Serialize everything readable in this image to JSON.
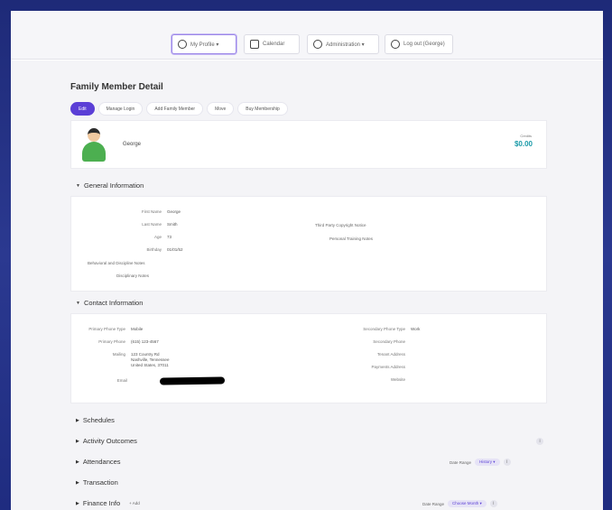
{
  "topbar": {
    "buttons": [
      {
        "label": "My Profile ▾",
        "icon": "user-circle-icon"
      },
      {
        "label": "Calendar",
        "icon": "calendar-icon"
      },
      {
        "label": "Administration ▾",
        "icon": "gear-icon"
      },
      {
        "label": "Log out (George)",
        "icon": "logout-icon"
      }
    ]
  },
  "page": {
    "title": "Family Member Detail",
    "tabs": [
      "Edit",
      "Manage Login",
      "Add Family Member",
      "Move",
      "Buy Membership"
    ]
  },
  "profile": {
    "name": "George",
    "stat_label": "Credits",
    "stat_value": "$0.00"
  },
  "general": {
    "header": "General Information",
    "fields": [
      {
        "k": "First Name",
        "v": "George"
      },
      {
        "k": "Last Name",
        "v": "Smith"
      },
      {
        "k": "Age",
        "v": "73"
      },
      {
        "k": "Birthday",
        "v": "01/01/52"
      }
    ],
    "right_fields": [
      {
        "k": "Third Party Copyright Notice",
        "v": ""
      },
      {
        "k": "Personal Training Notes",
        "v": ""
      }
    ],
    "flags": [
      "Behavioral and Discipline Notes",
      "Disciplinary Notes"
    ]
  },
  "contact": {
    "header": "Contact Information",
    "left": [
      {
        "k": "Primary Phone Type",
        "v": "Mobile"
      },
      {
        "k": "Primary Phone",
        "v": "(615) 123-4567"
      },
      {
        "k": "Mailing",
        "v": "123 Country Rd"
      },
      {
        "k": "",
        "v": "Nashville, Tennessee"
      },
      {
        "k": "",
        "v": "United States, 37011"
      },
      {
        "k": "Email",
        "v": ""
      }
    ],
    "right": [
      {
        "k": "Secondary Phone Type",
        "v": "Work"
      },
      {
        "k": "Secondary Phone",
        "v": ""
      },
      {
        "k": "Tenant Address",
        "v": ""
      },
      {
        "k": "Payments Address",
        "v": ""
      },
      {
        "k": "Website",
        "v": ""
      }
    ]
  },
  "sections": [
    {
      "label": "Schedules"
    },
    {
      "label": "Activity Outcomes"
    },
    {
      "label": "Attendances",
      "right_text": "Date Range",
      "pill": "History ▾"
    },
    {
      "label": "Transaction"
    },
    {
      "label": "Finance Info",
      "tag": "+ Add",
      "right_text": "Date Range",
      "pill": "Choose Month ▾"
    }
  ],
  "colors": {
    "accent": "#5b3fd6",
    "stat": "#1a9aa8",
    "avatar": "#4caf50"
  }
}
